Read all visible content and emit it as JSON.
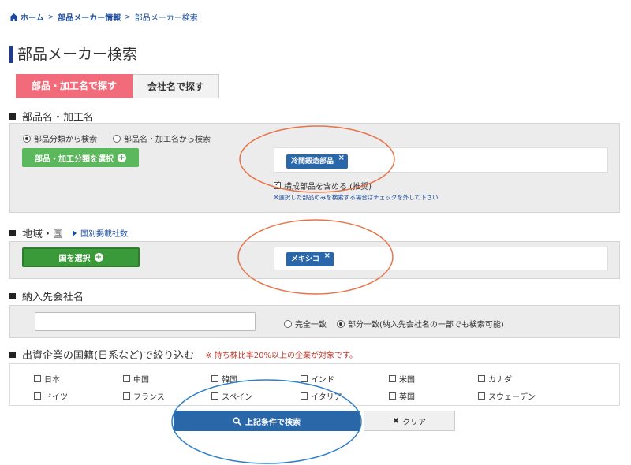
{
  "breadcrumb": {
    "home": "ホーム",
    "parent": "部品メーカー情報",
    "current": "部品メーカー検索",
    "sep": ">"
  },
  "page": {
    "title": "部品メーカー検索"
  },
  "tabs": [
    {
      "label": "部品・加工名で探す",
      "active": true
    },
    {
      "label": "会社名で探す",
      "active": false
    }
  ],
  "parts_section": {
    "heading": "部品名・加工名",
    "radio_category": "部品分類から検索",
    "radio_name": "部品名・加工名から検索",
    "select_button": "部品・加工分類を選択",
    "selected_tag": "冷間鍛造部品",
    "include_label": "構成部品を含める (推奨)",
    "include_note": "※選択した部品のみを検索する場合はチェックを外して下さい"
  },
  "region_section": {
    "heading": "地域・国",
    "link": "国別掲載社数",
    "select_button": "国を選択",
    "selected_tag": "メキシコ"
  },
  "customer_section": {
    "heading": "納入先会社名",
    "input_value": "",
    "radio_exact": "完全一致",
    "radio_partial": "部分一致(納入先会社名の一部でも検索可能)"
  },
  "capital_section": {
    "heading": "出資企業の国籍(日系など)で絞り込む",
    "note": "※ 持ち株比率20%以上の企業が対象です。",
    "countries": [
      "日本",
      "中国",
      "韓国",
      "インド",
      "米国",
      "カナダ",
      "ドイツ",
      "フランス",
      "スペイン",
      "イタリア",
      "英国",
      "スウェーデン"
    ]
  },
  "actions": {
    "search": "上記条件で検索",
    "clear": "クリア"
  },
  "colors": {
    "accent_blue": "#2a67a8",
    "tab_active": "#f26b7a",
    "green": "#5cb85c",
    "annotation_orange": "#e8734a",
    "annotation_blue": "#2f7fc9"
  }
}
